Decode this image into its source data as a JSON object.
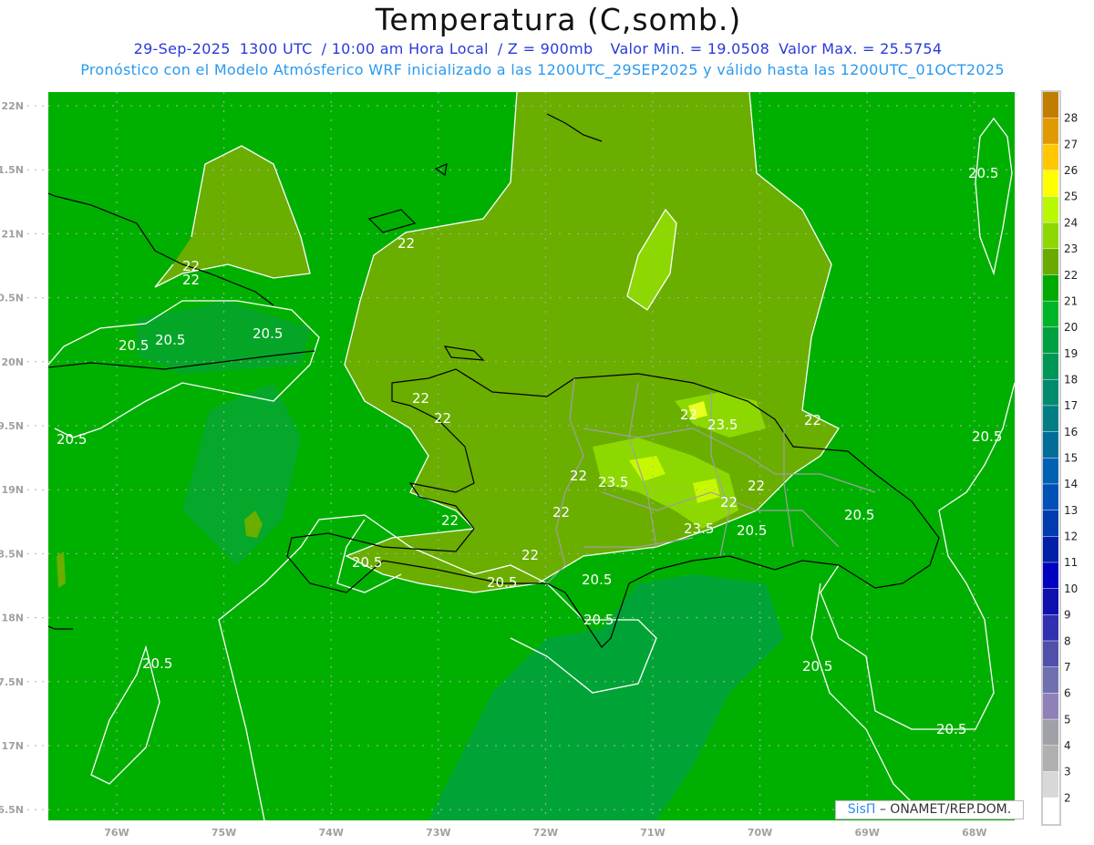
{
  "header": {
    "title": "Temperatura (C,somb.)",
    "date": "29-Sep-2025",
    "time_utc": "1300 UTC",
    "local_time": "/ 10:00 am Hora Local",
    "level": "/ Z = 900mb",
    "min": "Valor Min. = 19.0508",
    "max": "Valor Max. = 25.5754",
    "model_line": "Pronóstico con el Modelo Atmósferico WRF inicializado a las 1200UTC_29SEP2025 y válido hasta las  1200UTC_01OCT2025"
  },
  "axes": {
    "lat_labels": [
      "22N",
      "1.5N",
      "21N",
      "0.5N",
      "20N",
      "9.5N",
      "19N",
      "8.5N",
      "18N",
      "7.5N",
      "17N",
      "6.5N"
    ],
    "lon_labels": [
      "76W",
      "75W",
      "74W",
      "73W",
      "72W",
      "71W",
      "70W",
      "69W",
      "68W"
    ]
  },
  "colorbar": {
    "labels": [
      "28",
      "27",
      "26",
      "25",
      "24",
      "23",
      "22",
      "21",
      "20",
      "19",
      "18",
      "17",
      "16",
      "15",
      "14",
      "13",
      "12",
      "11",
      "10",
      "9",
      "8",
      "7",
      "6",
      "5",
      "4",
      "3",
      "2"
    ],
    "colors": [
      "#c07e00",
      "#e09a00",
      "#ffc800",
      "#ffff00",
      "#b8f800",
      "#8cd800",
      "#6aaa00",
      "#00aa00",
      "#00b428",
      "#00a040",
      "#009656",
      "#008a6e",
      "#007e84",
      "#006e98",
      "#0060b4",
      "#0050b8",
      "#003cb0",
      "#0020a8",
      "#0000c0",
      "#1010b0",
      "#3030b0",
      "#5050aa",
      "#7070b0",
      "#9080b8",
      "#a0a0a8",
      "#b0b0b0",
      "#d8d8d8",
      "#ffffff"
    ]
  },
  "contour_labels": [
    "22",
    "20.5",
    "23.5"
  ],
  "credit": {
    "brand": "SisΠ",
    "text": "– ONAMET/REP.DOM."
  }
}
